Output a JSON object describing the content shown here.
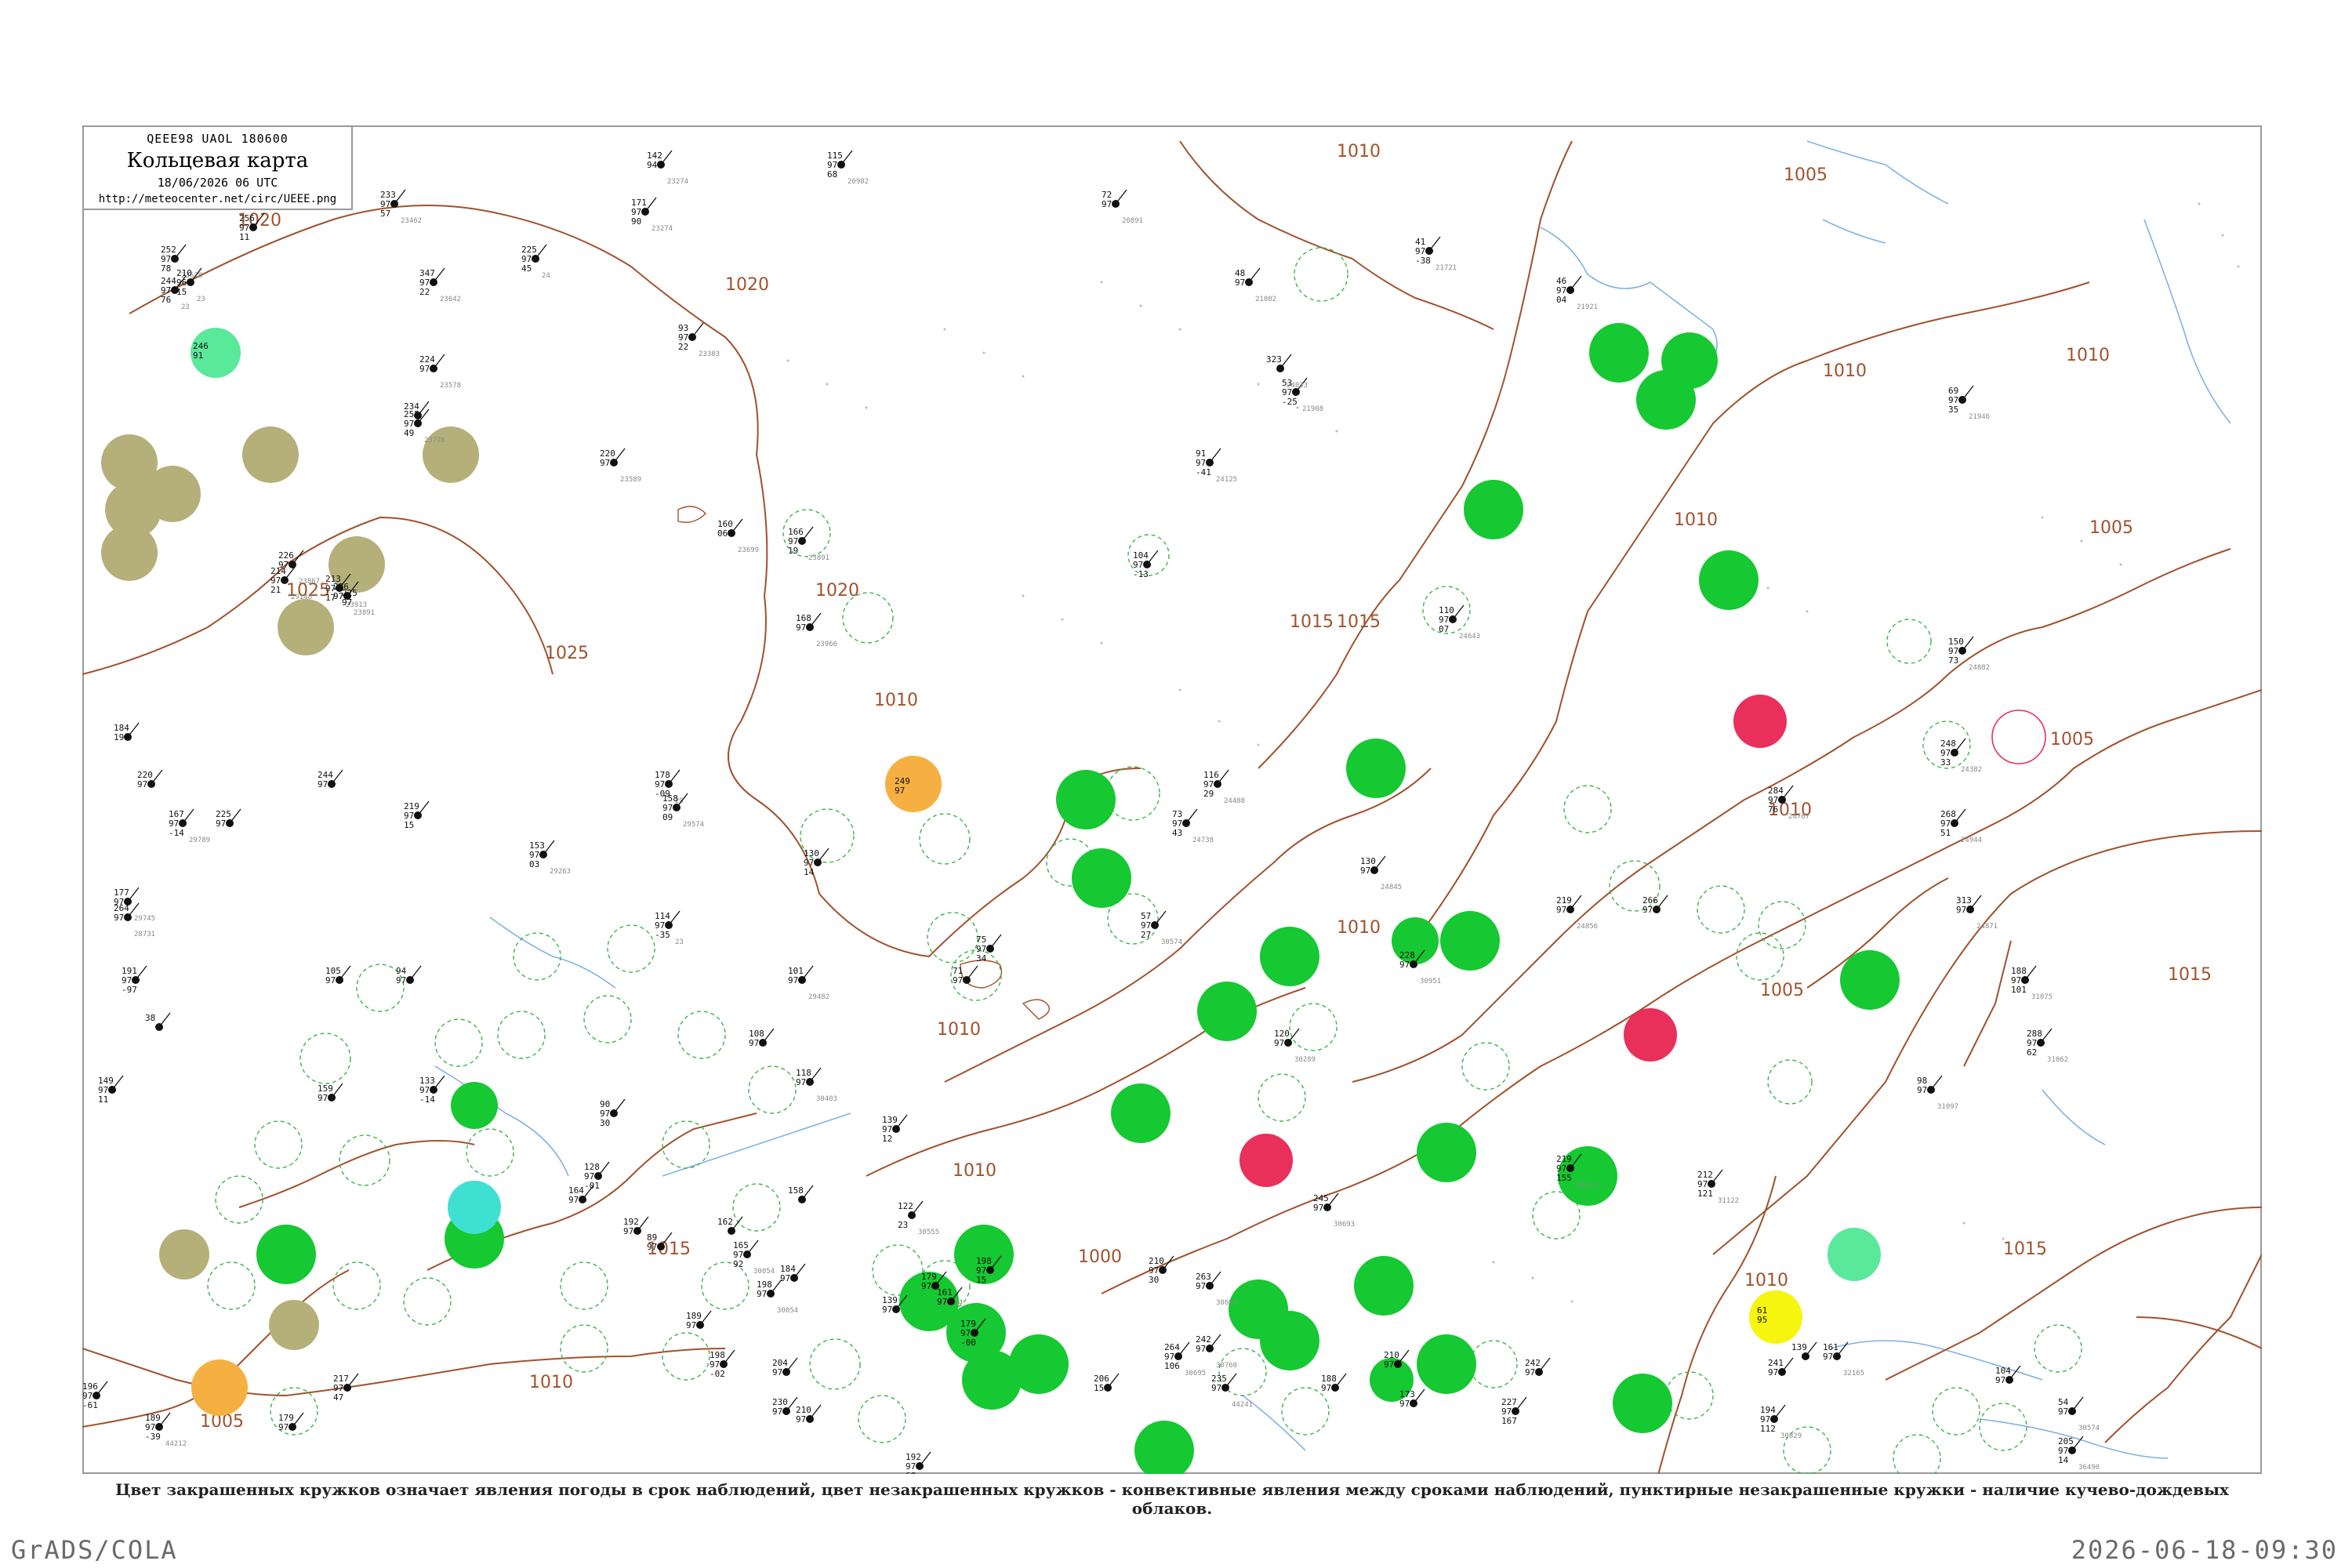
{
  "header": {
    "code_line": "QEEE98  UAOL  180600",
    "title": "Кольцевая карта",
    "datetime": "18/06/2026 06 UTC",
    "url": "http://meteocenter.net/circ/UEEE.png"
  },
  "caption": "Цвет закрашенных кружков означает явления погоды в срок наблюдений, цвет незакрашенных кружков - конвективные явления между сроками наблюдений, пунктирные незакрашенные кружки - наличие кучево-дождевых облаков.",
  "footer": {
    "left": "GrADS/COLA",
    "right": "2026-06-18-09:30"
  },
  "colors": {
    "isobar": "#a0522d",
    "river": "#7fb2e5",
    "rain_green": "#16c832",
    "cb_dashed": "#3cb44b",
    "thunder_red": "#e8305a",
    "haze_olive": "#b5b07a",
    "snow_mint": "#5ae89a",
    "fog_cyan": "#3ee0d2",
    "orange": "#f5b041",
    "yellow": "#f5f50f"
  },
  "isobar_labels": [
    "1020",
    "1025",
    "1020",
    "1015",
    "1010",
    "1005",
    "1010",
    "1010",
    "1005",
    "1005",
    "1010",
    "1015",
    "1020",
    "1010",
    "1000",
    "1005",
    "1010",
    "1015",
    "1010",
    "1015",
    "1025",
    "1010",
    "1005",
    "1010",
    "1015",
    "1005",
    "1010",
    "1010"
  ],
  "stations": [
    {
      "t": "244",
      "p": "97",
      "d": "76",
      "id": "23"
    },
    {
      "t": "252",
      "p": "97",
      "d": "78",
      "id": "23678"
    },
    {
      "t": "256",
      "p": "97",
      "d": "11",
      "id": ""
    },
    {
      "t": "210",
      "p": "96",
      "d": "15",
      "id": "23"
    },
    {
      "t": "233",
      "p": "97",
      "d": "57",
      "id": "23462"
    },
    {
      "t": "347",
      "p": "97",
      "d": "22",
      "id": "23642"
    },
    {
      "t": "225",
      "p": "97",
      "d": "45",
      "id": "24"
    },
    {
      "t": "171",
      "p": "97",
      "d": "90",
      "id": "23274"
    },
    {
      "t": "142",
      "p": "94",
      "d": "",
      "id": "23274"
    },
    {
      "t": "115",
      "p": "97",
      "d": "68",
      "id": "20982"
    },
    {
      "t": "72",
      "p": "97",
      "d": "",
      "id": "20891"
    },
    {
      "t": "93",
      "p": "97",
      "d": "22",
      "id": "23383"
    },
    {
      "t": "48",
      "p": "97",
      "d": "",
      "id": "21802"
    },
    {
      "t": "41",
      "p": "97",
      "d": "-38",
      "id": "21721"
    },
    {
      "t": "46",
      "p": "97",
      "d": "04",
      "id": "21921"
    },
    {
      "t": "53",
      "p": "97",
      "d": "-25",
      "id": "21908"
    },
    {
      "t": "91",
      "p": "97",
      "d": "-41",
      "id": "24125"
    },
    {
      "t": "323",
      "p": "",
      "d": "",
      "id": "24033"
    },
    {
      "t": "69",
      "p": "97",
      "d": "35",
      "id": "21946"
    },
    {
      "t": "224",
      "p": "97",
      "d": "",
      "id": "23578"
    },
    {
      "t": "255",
      "p": "97",
      "d": "49",
      "id": "23776"
    },
    {
      "t": "234",
      "p": "",
      "d": "",
      "id": ""
    },
    {
      "t": "220",
      "p": "97",
      "d": "",
      "id": "23589"
    },
    {
      "t": "160",
      "p": "06",
      "d": "",
      "id": "23699"
    },
    {
      "t": "166",
      "p": "97",
      "d": "19",
      "id": "23891"
    },
    {
      "t": "104",
      "p": "97",
      "d": "-13",
      "id": ""
    },
    {
      "t": "110",
      "p": "97",
      "d": "07",
      "id": "24643"
    },
    {
      "t": "150",
      "p": "97",
      "d": "73",
      "id": "24882"
    },
    {
      "t": "248",
      "p": "97",
      "d": "33",
      "id": "24382"
    },
    {
      "t": "214",
      "p": "97",
      "d": "21",
      "id": "29148"
    },
    {
      "t": "226",
      "p": "97",
      "d": "",
      "id": "23867"
    },
    {
      "t": "213",
      "p": "97",
      "d": "17",
      "id": "23913"
    },
    {
      "t": "226",
      "p": "97",
      "d": "",
      "id": "23891"
    },
    {
      "t": "168",
      "p": "97",
      "d": "",
      "id": "23966"
    },
    {
      "t": "116",
      "p": "97",
      "d": "29",
      "id": "24488"
    },
    {
      "t": "73",
      "p": "97",
      "d": "43",
      "id": "24738"
    },
    {
      "t": "284",
      "p": "97",
      "d": "76",
      "id": "24767"
    },
    {
      "t": "268",
      "p": "97",
      "d": "51",
      "id": "24944"
    },
    {
      "t": "178",
      "p": "97",
      "d": "-09",
      "id": "29"
    },
    {
      "t": "158",
      "p": "97",
      "d": "09",
      "id": "29574"
    },
    {
      "t": "130",
      "p": "97",
      "d": "14",
      "id": ""
    },
    {
      "t": "153",
      "p": "97",
      "d": "03",
      "id": "29263"
    },
    {
      "t": "114",
      "p": "97",
      "d": "-35",
      "id": "23"
    },
    {
      "t": "101",
      "p": "97",
      "d": "",
      "id": "29482"
    },
    {
      "t": "108",
      "p": "97",
      "d": "",
      "id": ""
    },
    {
      "t": "118",
      "p": "97",
      "d": "",
      "id": "30403"
    },
    {
      "t": "75",
      "p": "97",
      "d": "34",
      "id": ""
    },
    {
      "t": "71",
      "p": "97",
      "d": "",
      "id": ""
    },
    {
      "t": "57",
      "p": "97",
      "d": "27",
      "id": "30574"
    },
    {
      "t": "120",
      "p": "97",
      "d": "",
      "id": "30289"
    },
    {
      "t": "130",
      "p": "97",
      "d": "",
      "id": "24845"
    },
    {
      "t": "228",
      "p": "97",
      "d": "",
      "id": "30951"
    },
    {
      "t": "219",
      "p": "97",
      "d": "",
      "id": "24856"
    },
    {
      "t": "266",
      "p": "97",
      "d": "",
      "id": ""
    },
    {
      "t": "313",
      "p": "97",
      "d": "",
      "id": "24871"
    },
    {
      "t": "188",
      "p": "97",
      "d": "101",
      "id": "31075"
    },
    {
      "t": "288",
      "p": "97",
      "d": "62",
      "id": "31062"
    },
    {
      "t": "98",
      "p": "97",
      "d": "",
      "id": "31097"
    },
    {
      "t": "219",
      "p": "97",
      "d": "155",
      "id": "30123"
    },
    {
      "t": "212",
      "p": "97",
      "d": "121",
      "id": "31122"
    },
    {
      "t": "245",
      "p": "97",
      "d": "",
      "id": "30693"
    },
    {
      "t": "263",
      "p": "97",
      "d": "",
      "id": "30697"
    },
    {
      "t": "264",
      "p": "97",
      "d": "106",
      "id": "30695"
    },
    {
      "t": "242",
      "p": "97",
      "d": "",
      "id": "30760"
    },
    {
      "t": "206",
      "p": "154",
      "d": "",
      "id": ""
    },
    {
      "t": "179",
      "p": "97",
      "d": "",
      "id": "31034"
    },
    {
      "t": "184",
      "p": "97",
      "d": "",
      "id": ""
    },
    {
      "t": "198",
      "p": "97",
      "d": "",
      "id": "30054"
    },
    {
      "t": "204",
      "p": "97",
      "d": "",
      "id": ""
    },
    {
      "t": "210",
      "p": "97",
      "d": "",
      "id": ""
    },
    {
      "t": "192",
      "p": "97",
      "d": "68",
      "id": "30937"
    },
    {
      "t": "230",
      "p": "97",
      "d": "",
      "id": ""
    },
    {
      "t": "189",
      "p": "97",
      "d": "-39",
      "id": "44212"
    },
    {
      "t": "196",
      "p": "97",
      "d": "-61",
      "id": ""
    },
    {
      "t": "217",
      "p": "97",
      "d": "47",
      "id": ""
    },
    {
      "t": "179",
      "p": "97",
      "d": "",
      "id": ""
    },
    {
      "t": "235",
      "p": "97",
      "d": "",
      "id": "44241"
    },
    {
      "t": "210",
      "p": "97",
      "d": "",
      "id": ""
    },
    {
      "t": "173",
      "p": "97",
      "d": "",
      "id": ""
    },
    {
      "t": "188",
      "p": "97",
      "d": "",
      "id": ""
    },
    {
      "t": "227",
      "p": "97",
      "d": "167",
      "id": ""
    },
    {
      "t": "242",
      "p": "97",
      "d": "",
      "id": ""
    },
    {
      "t": "241",
      "p": "97",
      "d": "",
      "id": ""
    },
    {
      "t": "194",
      "p": "97",
      "d": "112",
      "id": "30829"
    },
    {
      "t": "139",
      "p": "",
      "d": "",
      "id": ""
    },
    {
      "t": "104",
      "p": "97",
      "d": "",
      "id": ""
    },
    {
      "t": "161",
      "p": "97",
      "d": "",
      "id": "32165"
    },
    {
      "t": "54",
      "p": "97",
      "d": "",
      "id": "30574"
    },
    {
      "t": "205",
      "p": "97",
      "d": "14",
      "id": "36490"
    },
    {
      "t": "210",
      "p": "97",
      "d": "30",
      "id": ""
    },
    {
      "t": "191",
      "p": "97",
      "d": "-97",
      "id": ""
    },
    {
      "t": "38",
      "p": "",
      "d": "",
      "id": ""
    },
    {
      "t": "149",
      "p": "97",
      "d": "11",
      "id": ""
    },
    {
      "t": "159",
      "p": "97",
      "d": "",
      "id": ""
    },
    {
      "t": "94",
      "p": "97",
      "d": "",
      "id": ""
    },
    {
      "t": "133",
      "p": "97",
      "d": "-14",
      "id": ""
    },
    {
      "t": "105",
      "p": "97",
      "d": "",
      "id": ""
    },
    {
      "t": "90",
      "p": "97",
      "d": "30",
      "id": ""
    },
    {
      "t": "128",
      "p": "97",
      "d": "-01",
      "id": ""
    },
    {
      "t": "164",
      "p": "97",
      "d": "",
      "id": ""
    },
    {
      "t": "192",
      "p": "97",
      "d": "",
      "id": ""
    },
    {
      "t": "89",
      "p": "97",
      "d": "",
      "id": ""
    },
    {
      "t": "162",
      "p": "",
      "d": "",
      "id": ""
    },
    {
      "t": "165",
      "p": "97",
      "d": "92",
      "id": "30054"
    },
    {
      "t": "158",
      "p": "",
      "d": "",
      "id": ""
    },
    {
      "t": "122",
      "p": "",
      "d": "23",
      "id": "30555"
    },
    {
      "t": "198",
      "p": "97",
      "d": "15",
      "id": ""
    },
    {
      "t": "139",
      "p": "97",
      "d": "12",
      "id": ""
    },
    {
      "t": "139",
      "p": "97",
      "d": "",
      "id": ""
    },
    {
      "t": "161",
      "p": "97",
      "d": "",
      "id": ""
    },
    {
      "t": "179",
      "p": "97",
      "d": "-00",
      "id": ""
    },
    {
      "t": "189",
      "p": "97",
      "d": "",
      "id": ""
    },
    {
      "t": "198",
      "p": "97",
      "d": "-02",
      "id": ""
    },
    {
      "t": "177",
      "p": "97",
      "d": "",
      "id": "29745"
    },
    {
      "t": "184",
      "p": "19",
      "d": "",
      "id": ""
    },
    {
      "t": "220",
      "p": "97",
      "d": "",
      "id": ""
    },
    {
      "t": "167",
      "p": "97",
      "d": "-14",
      "id": "29789"
    },
    {
      "t": "225",
      "p": "97",
      "d": "",
      "id": ""
    },
    {
      "t": "244",
      "p": "97",
      "d": "",
      "id": ""
    },
    {
      "t": "219",
      "p": "97",
      "d": "15",
      "id": ""
    },
    {
      "t": "264",
      "p": "97",
      "d": "",
      "id": "28731"
    }
  ],
  "weather_circles": [
    {
      "type": "green",
      "t": "",
      "p": ""
    },
    {
      "type": "olive",
      "t": "225",
      "p": "97"
    },
    {
      "type": "mint",
      "t": "246",
      "p": "91"
    },
    {
      "type": "red",
      "t": "",
      "p": ""
    },
    {
      "type": "yellow",
      "t": "61",
      "p": "95"
    },
    {
      "type": "orange",
      "t": "249",
      "p": "97"
    },
    {
      "type": "cyan",
      "t": "",
      "p": ""
    }
  ]
}
